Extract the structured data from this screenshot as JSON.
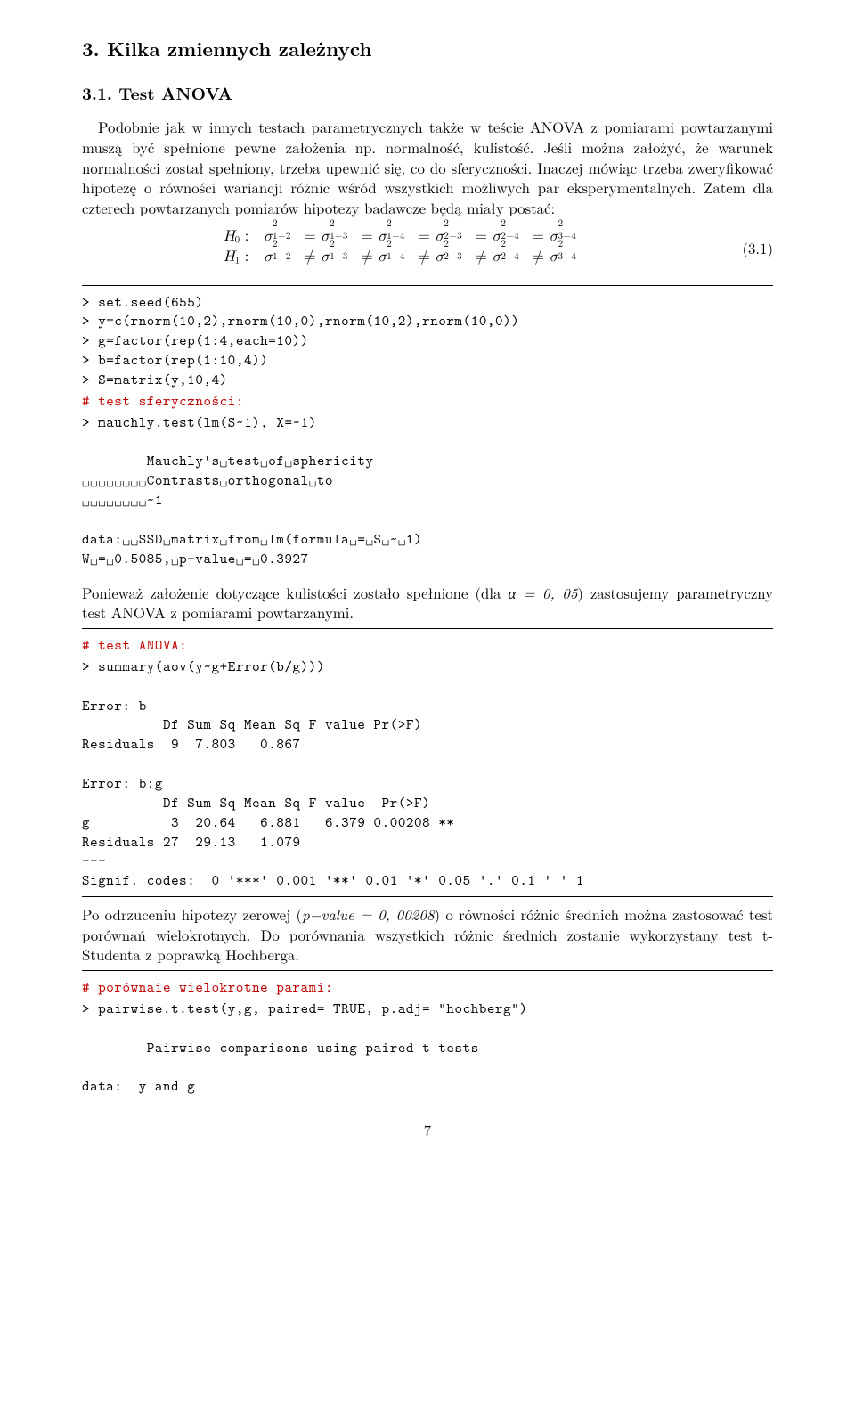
{
  "section": {
    "number": "3.",
    "title": "Kilka zmiennych zależnych"
  },
  "subsection": {
    "number": "3.1.",
    "title": "Test ANOVA"
  },
  "para1": "Podobnie jak w innych testach parametrycznych także w teście ANOVA z pomiarami powtarzanymi muszą być spełnione pewne założenia np. normalność, kulistość. Jeśli można założyć, że warunek normalności został spełniony, trzeba upewnić się, co do sferyczności. Inaczej mówiąc trzeba zweryfikować hipotezę o równości wariancji różnic wśród wszystkich możliwych par eksperymentalnych. Zatem dla czterech powtarzanych pomiarów hipotezy badawcze będą miały postać:",
  "eq": {
    "h0_label": "H",
    "h0_sub": "0",
    "h1_sub": "1",
    "colon": " :   ",
    "sigma": "σ",
    "eqn_num": "(3.1)"
  },
  "code1_comment": "# test sferyczności:",
  "code1": "> set.seed(655)\n> y=c(rnorm(10,2),rnorm(10,0),rnorm(10,2),rnorm(10,0))\n> g=factor(rep(1:4,each=10))\n> b=factor(rep(1:10,4))\n> S=matrix(y,10,4)",
  "code1b": "> mauchly.test(lm(S~1), X=~1)\n\n        Mauchly's␣test␣of␣sphericity\n␣␣␣␣␣␣␣␣Contrasts␣orthogonal␣to\n␣␣␣␣␣␣␣␣~1\n\ndata:␣␣SSD␣matrix␣from␣lm(formula␣=␣S␣~␣1)\nW␣=␣0.5085,␣p-value␣=␣0.3927",
  "para2_pre": "Ponieważ założenie dotyczące kulistości zostało spełnione (dla ",
  "para2_alpha": "α = 0, 05",
  "para2_post": ") zastosujemy parametryczny test ANOVA z pomiarami powtarzanymi.",
  "code2_comment": "# test ANOVA:",
  "code2": "> summary(aov(y~g+Error(b/g)))\n\nError: b\n          Df Sum Sq Mean Sq F value Pr(>F)\nResiduals  9  7.803   0.867\n\nError: b:g\n          Df Sum Sq Mean Sq F value  Pr(>F)\ng          3  20.64   6.881   6.379 0.00208 **\nResiduals 27  29.13   1.079\n---\nSignif. codes:  0 '***' 0.001 '**' 0.01 '*' 0.05 '.' 0.1 ' ' 1",
  "para3_pre": "Po odrzuceniu hipotezy zerowej (",
  "para3_mid": "p−value = 0, 00208",
  "para3_post": ") o równości różnic średnich można zastosować test porównań wielokrotnych. Do porównania wszystkich różnic średnich zostanie wykorzystany test t-Studenta z poprawką Hochberga.",
  "code3_comment": "# porównaie wielokrotne parami:",
  "code3": "> pairwise.t.test(y,g, paired= TRUE, p.adj= \"hochberg\")\n\n        Pairwise comparisons using paired t tests\n\ndata:  y and g",
  "page_number": "7"
}
